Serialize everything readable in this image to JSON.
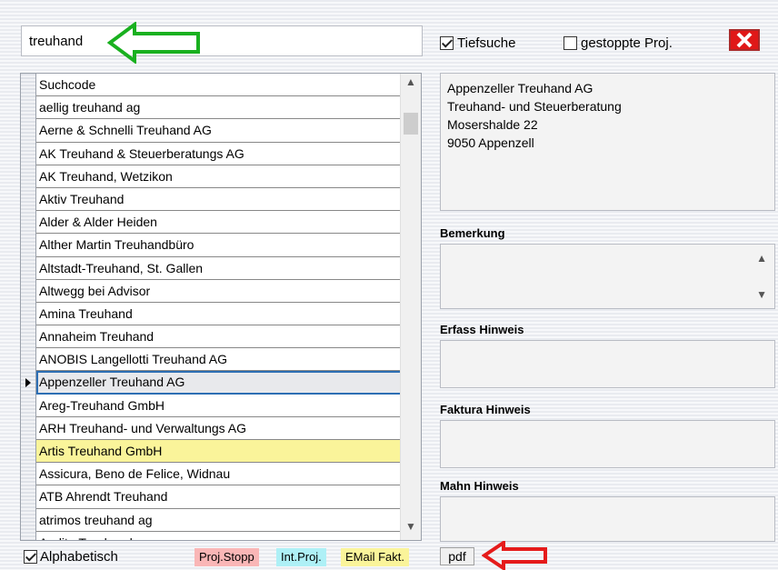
{
  "search": {
    "value": "treuhand"
  },
  "options": {
    "tiefsuche": {
      "label": "Tiefsuche",
      "checked": true
    },
    "gestoppte": {
      "label": "gestoppte Proj.",
      "checked": false
    }
  },
  "icons": {
    "close": "close-x-icon",
    "green_arrow": "left-arrow-icon",
    "red_arrow": "left-arrow-icon"
  },
  "list": {
    "header": "Suchcode",
    "items": [
      "aellig treuhand ag",
      "Aerne & Schnelli Treuhand AG",
      "AK Treuhand & Steuerberatungs AG",
      "AK Treuhand, Wetzikon",
      "Aktiv Treuhand",
      "Alder & Alder Heiden",
      "Alther Martin Treuhandbüro",
      "Altstadt-Treuhand, St. Gallen",
      "Altwegg bei Advisor",
      "Amina Treuhand",
      "Annaheim Treuhand",
      "ANOBIS Langellotti Treuhand AG",
      "Appenzeller Treuhand AG",
      "Areg-Treuhand GmbH",
      "ARH Treuhand- und Verwaltungs AG",
      "Artis Treuhand GmbH",
      "Assicura, Beno de Felice, Widnau",
      "ATB Ahrendt Treuhand",
      "atrimos treuhand ag",
      "Audita Treuhand"
    ],
    "selected_index": 12,
    "highlight_index": 15
  },
  "bottom": {
    "alphabetisch": {
      "label": "Alphabetisch",
      "checked": true
    },
    "tags": [
      {
        "label": "Proj.Stopp",
        "color": "#f9b6b6"
      },
      {
        "label": "Int.Proj.",
        "color": "#aef0f6"
      },
      {
        "label": "EMail Fakt.",
        "color": "#faf49a"
      }
    ],
    "pdf": "pdf"
  },
  "detail": {
    "address_lines": [
      "Appenzeller Treuhand AG",
      "Treuhand- und Steuerberatung",
      "Mosershalde 22",
      "9050 Appenzell"
    ],
    "bemerkung": "Bemerkung",
    "erfass": "Erfass Hinweis",
    "faktura": "Faktura Hinweis",
    "mahn": "Mahn Hinweis"
  },
  "colors": {
    "selected_outline": "#2d6fb4",
    "close_red": "#e01818",
    "green_arrow": "#19b01f",
    "red_arrow": "#e51b1b"
  }
}
